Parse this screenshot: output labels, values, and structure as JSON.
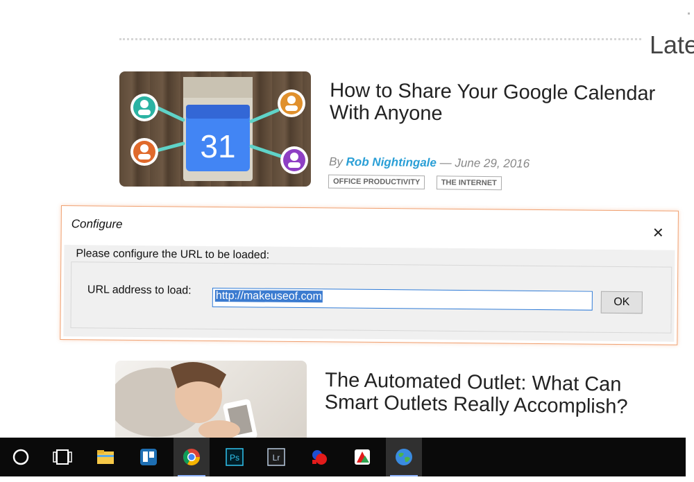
{
  "section": {
    "heading": "Late"
  },
  "articles": [
    {
      "title": "How to Share Your Google Calendar With Anyone",
      "byline_prefix": "By",
      "author": "Rob Nightingale",
      "separator": "—",
      "date": "June 29, 2016",
      "tags": [
        "OFFICE PRODUCTIVITY",
        "THE INTERNET"
      ],
      "thumbnail": {
        "calendar_day": "31"
      }
    },
    {
      "title": "The Automated Outlet: What Can Smart Outlets Really Accomplish?"
    }
  ],
  "dialog": {
    "title": "Configure",
    "close_label": "✕",
    "group_label": "Please configure the URL to be loaded:",
    "url_label": "URL address to load:",
    "url_value": "http://makeuseof.com",
    "ok_label": "OK"
  },
  "taskbar": {
    "items": [
      {
        "icon": "cortana-circle-icon"
      },
      {
        "icon": "task-view-icon"
      },
      {
        "icon": "file-explorer-icon"
      },
      {
        "icon": "trello-icon"
      },
      {
        "icon": "chrome-icon",
        "active": true
      },
      {
        "icon": "photoshop-icon",
        "text": "Ps"
      },
      {
        "icon": "lightroom-icon",
        "text": "Lr"
      },
      {
        "icon": "app-red-blue-icon"
      },
      {
        "icon": "app-red-green-icon"
      },
      {
        "icon": "globe-icon",
        "active": true
      }
    ]
  },
  "colors": {
    "accent_author": "#2a9fd6",
    "dialog_border": "#f0a070",
    "input_border": "#2e7ad6",
    "selection": "#3b7bd0",
    "taskbar": "#0a0a0a"
  }
}
